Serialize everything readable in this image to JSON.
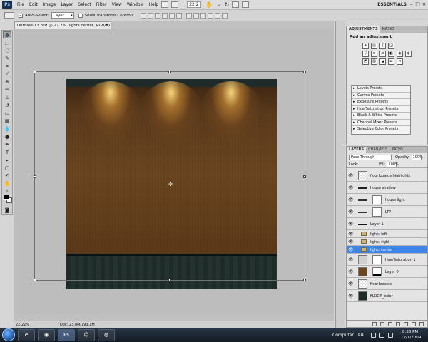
{
  "menubar": {
    "logo": "Ps",
    "items": [
      "File",
      "Edit",
      "Image",
      "Layer",
      "Select",
      "Filter",
      "View",
      "Window",
      "Help"
    ],
    "zoom": "22.2",
    "workspace": "ESSENTIALS"
  },
  "options": {
    "auto_select_label": "Auto-Select:",
    "auto_select_value": "Layer",
    "transform_label": "Show Transform Controls"
  },
  "document": {
    "tab_title": "Untitled-13.psd @ 22.2% (lights center, RGB/8) *",
    "status_zoom": "22.22%",
    "status_doc": "Doc: 23.0M/193.1M"
  },
  "adjustments": {
    "tabs": [
      "ADJUSTMENTS",
      "MASKS"
    ],
    "title": "Add an adjustment",
    "presets": [
      "Levels Presets",
      "Curves Presets",
      "Exposure Presets",
      "Hue/Saturation Presets",
      "Black & White Presets",
      "Channel Mixer Presets",
      "Selective Color Presets"
    ]
  },
  "layers": {
    "tabs": [
      "LAYERS",
      "CHANNELS",
      "PATHS"
    ],
    "blend_mode": "Pass Through",
    "opacity_label": "Opacity:",
    "opacity": "100%",
    "lock_label": "Lock:",
    "fill_label": "Fill:",
    "fill": "100%",
    "rows": [
      {
        "name": "floor boards highlights",
        "kind": "layer"
      },
      {
        "name": "house shadow",
        "kind": "line"
      },
      {
        "name": "house light",
        "kind": "mask"
      },
      {
        "name": "LTP",
        "kind": "mask"
      },
      {
        "name": "Layer 1",
        "kind": "line"
      },
      {
        "name": "lights left",
        "kind": "group"
      },
      {
        "name": "lights right",
        "kind": "group"
      },
      {
        "name": "lights center",
        "kind": "group",
        "selected": true
      },
      {
        "name": "Hue/Saturation 1",
        "kind": "adjust"
      },
      {
        "name": "Layer 0",
        "kind": "wood"
      },
      {
        "name": "floor boards",
        "kind": "layer"
      },
      {
        "name": "FLOOR_color",
        "kind": "dark"
      }
    ]
  },
  "taskbar": {
    "computer": "Computer",
    "lang": "EN",
    "time": "8:56 PM",
    "date": "12/1/2009"
  },
  "colors": {
    "selected_layer": "#3d86e6",
    "wood": "#6a4520",
    "floor": "#243230"
  }
}
